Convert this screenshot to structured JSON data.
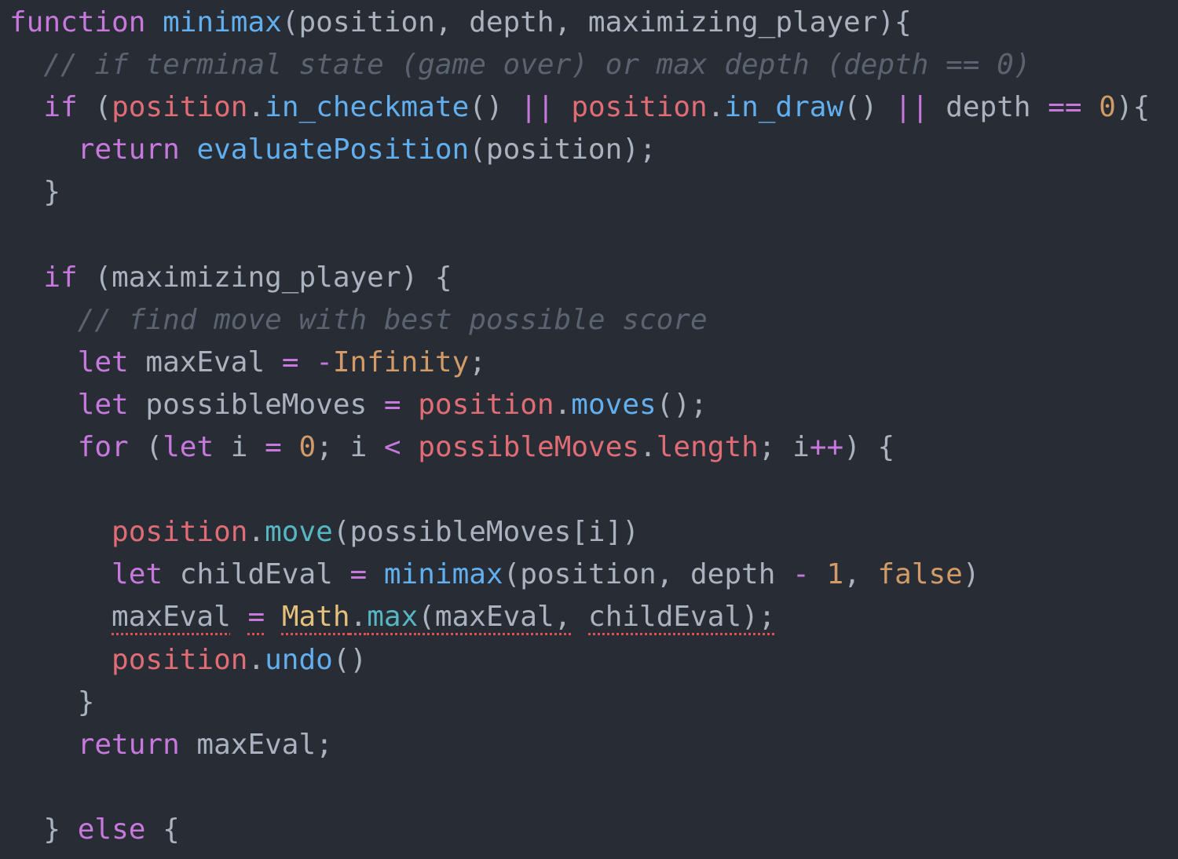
{
  "editor": {
    "theme_colors": {
      "background": "#282c34",
      "keyword": "#c678dd",
      "function": "#61afef",
      "identifier": "#abb2bf",
      "variable": "#e06c75",
      "number": "#d19a66",
      "class": "#e5c07b",
      "method": "#56b6c2",
      "comment": "#5c6370",
      "lint_underline": "#e05252"
    },
    "lines": [
      {
        "indent": 0,
        "tokens": [
          {
            "t": "function",
            "c": "kw"
          },
          {
            "t": " ",
            "c": "punc"
          },
          {
            "t": "minimax",
            "c": "fn"
          },
          {
            "t": "(position, depth, maximizing_player){",
            "c": "punc"
          }
        ]
      },
      {
        "indent": 1,
        "tokens": [
          {
            "t": "// if terminal state (game over) or max depth (depth == 0)",
            "c": "cmt"
          }
        ]
      },
      {
        "indent": 1,
        "tokens": [
          {
            "t": "if",
            "c": "kw"
          },
          {
            "t": " (",
            "c": "punc"
          },
          {
            "t": "position",
            "c": "var"
          },
          {
            "t": ".",
            "c": "punc"
          },
          {
            "t": "in_checkmate",
            "c": "fn"
          },
          {
            "t": "() ",
            "c": "punc"
          },
          {
            "t": "||",
            "c": "op"
          },
          {
            "t": " ",
            "c": "punc"
          },
          {
            "t": "position",
            "c": "var"
          },
          {
            "t": ".",
            "c": "punc"
          },
          {
            "t": "in_draw",
            "c": "fn"
          },
          {
            "t": "() ",
            "c": "punc"
          },
          {
            "t": "||",
            "c": "op"
          },
          {
            "t": " depth ",
            "c": "punc"
          },
          {
            "t": "==",
            "c": "op"
          },
          {
            "t": " ",
            "c": "punc"
          },
          {
            "t": "0",
            "c": "num"
          },
          {
            "t": "){",
            "c": "punc"
          }
        ]
      },
      {
        "indent": 2,
        "tokens": [
          {
            "t": "return",
            "c": "kw"
          },
          {
            "t": " ",
            "c": "punc"
          },
          {
            "t": "evaluatePosition",
            "c": "fn"
          },
          {
            "t": "(position);",
            "c": "punc"
          }
        ]
      },
      {
        "indent": 1,
        "tokens": [
          {
            "t": "}",
            "c": "punc"
          }
        ]
      },
      {
        "indent": 0,
        "tokens": []
      },
      {
        "indent": 1,
        "tokens": [
          {
            "t": "if",
            "c": "kw"
          },
          {
            "t": " (maximizing_player) {",
            "c": "punc"
          }
        ]
      },
      {
        "indent": 2,
        "tokens": [
          {
            "t": "// find move with best possible score",
            "c": "cmt"
          }
        ]
      },
      {
        "indent": 2,
        "tokens": [
          {
            "t": "let",
            "c": "kw"
          },
          {
            "t": " maxEval ",
            "c": "punc"
          },
          {
            "t": "=",
            "c": "op"
          },
          {
            "t": " ",
            "c": "punc"
          },
          {
            "t": "-",
            "c": "op"
          },
          {
            "t": "Infinity",
            "c": "num"
          },
          {
            "t": ";",
            "c": "punc"
          }
        ]
      },
      {
        "indent": 2,
        "tokens": [
          {
            "t": "let",
            "c": "kw"
          },
          {
            "t": " possibleMoves ",
            "c": "punc"
          },
          {
            "t": "=",
            "c": "op"
          },
          {
            "t": " ",
            "c": "punc"
          },
          {
            "t": "position",
            "c": "var"
          },
          {
            "t": ".",
            "c": "punc"
          },
          {
            "t": "moves",
            "c": "fn"
          },
          {
            "t": "();",
            "c": "punc"
          }
        ]
      },
      {
        "indent": 2,
        "tokens": [
          {
            "t": "for",
            "c": "kw"
          },
          {
            "t": " (",
            "c": "punc"
          },
          {
            "t": "let",
            "c": "kw"
          },
          {
            "t": " i ",
            "c": "punc"
          },
          {
            "t": "=",
            "c": "op"
          },
          {
            "t": " ",
            "c": "punc"
          },
          {
            "t": "0",
            "c": "num"
          },
          {
            "t": "; i ",
            "c": "punc"
          },
          {
            "t": "<",
            "c": "op"
          },
          {
            "t": " ",
            "c": "punc"
          },
          {
            "t": "possibleMoves",
            "c": "var"
          },
          {
            "t": ".",
            "c": "punc"
          },
          {
            "t": "length",
            "c": "var"
          },
          {
            "t": "; i",
            "c": "punc"
          },
          {
            "t": "++",
            "c": "op"
          },
          {
            "t": ") {",
            "c": "punc"
          }
        ]
      },
      {
        "indent": 0,
        "tokens": []
      },
      {
        "indent": 3,
        "tokens": [
          {
            "t": "position",
            "c": "var"
          },
          {
            "t": ".",
            "c": "punc"
          },
          {
            "t": "move",
            "c": "mth"
          },
          {
            "t": "(possibleMoves[i])",
            "c": "punc"
          }
        ]
      },
      {
        "indent": 3,
        "tokens": [
          {
            "t": "let",
            "c": "kw"
          },
          {
            "t": " childEval ",
            "c": "punc"
          },
          {
            "t": "=",
            "c": "op"
          },
          {
            "t": " ",
            "c": "punc"
          },
          {
            "t": "minimax",
            "c": "fn"
          },
          {
            "t": "(position, depth ",
            "c": "punc"
          },
          {
            "t": "-",
            "c": "op"
          },
          {
            "t": " ",
            "c": "punc"
          },
          {
            "t": "1",
            "c": "num"
          },
          {
            "t": ", ",
            "c": "punc"
          },
          {
            "t": "false",
            "c": "bool"
          },
          {
            "t": ")",
            "c": "punc"
          }
        ]
      },
      {
        "indent": 3,
        "tokens": [
          {
            "t": "maxEval",
            "c": "id lint"
          },
          {
            "t": " ",
            "c": "punc"
          },
          {
            "t": "=",
            "c": "op lint"
          },
          {
            "t": " ",
            "c": "punc"
          },
          {
            "t": "Math",
            "c": "cls lint"
          },
          {
            "t": ".",
            "c": "punc lint"
          },
          {
            "t": "max",
            "c": "mth lint"
          },
          {
            "t": "(maxEval,",
            "c": "punc lint"
          },
          {
            "t": " ",
            "c": "punc"
          },
          {
            "t": "childEval);",
            "c": "punc lint"
          }
        ]
      },
      {
        "indent": 3,
        "tokens": [
          {
            "t": "position",
            "c": "var"
          },
          {
            "t": ".",
            "c": "punc"
          },
          {
            "t": "undo",
            "c": "fn"
          },
          {
            "t": "()",
            "c": "punc"
          }
        ]
      },
      {
        "indent": 2,
        "tokens": [
          {
            "t": "}",
            "c": "punc"
          }
        ]
      },
      {
        "indent": 2,
        "tokens": [
          {
            "t": "return",
            "c": "kw"
          },
          {
            "t": " maxEval;",
            "c": "punc"
          }
        ]
      },
      {
        "indent": 0,
        "tokens": []
      },
      {
        "indent": 1,
        "tokens": [
          {
            "t": "}",
            "c": "punc"
          },
          {
            "t": " ",
            "c": "punc"
          },
          {
            "t": "else",
            "c": "kw"
          },
          {
            "t": " {",
            "c": "punc"
          }
        ]
      }
    ]
  }
}
